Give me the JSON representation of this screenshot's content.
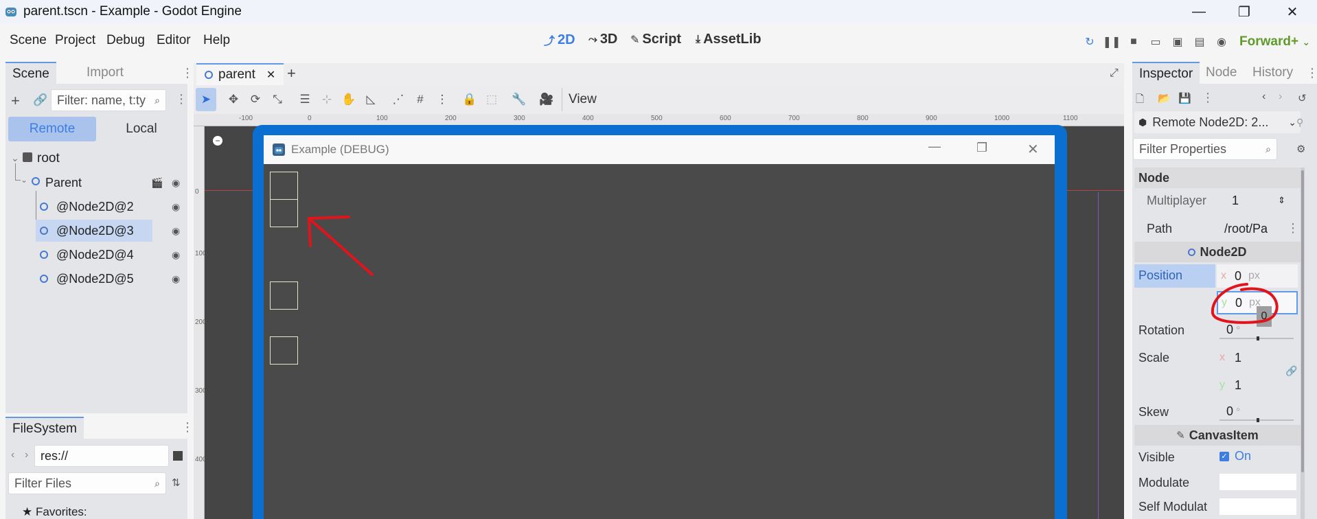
{
  "window": {
    "title": "parent.tscn - Example - Godot Engine",
    "minimize": "—",
    "maximize": "❐",
    "close": "✕"
  },
  "menu": [
    "Scene",
    "Project",
    "Debug",
    "Editor",
    "Help"
  ],
  "modes": {
    "twod": "2D",
    "threed": "3D",
    "script": "Script",
    "assetlib": "AssetLib"
  },
  "renderer": "Forward+",
  "scene_dock": {
    "tabs": [
      "Scene",
      "Import"
    ],
    "filter_placeholder": "Filter: name, t:ty",
    "remote": "Remote",
    "local": "Local",
    "tree": {
      "root": "root",
      "parent": "Parent",
      "children": [
        "@Node2D@2",
        "@Node2D@3",
        "@Node2D@4",
        "@Node2D@5"
      ]
    }
  },
  "filesystem_dock": {
    "tab": "FileSystem",
    "path": "res://",
    "filter_placeholder": "Filter Files",
    "favorites": "Favorites:"
  },
  "viewport": {
    "tab": "parent",
    "add_tab": "+",
    "view_menu": "View",
    "ruler_h": [
      "-100",
      "0",
      "100",
      "200",
      "300",
      "400",
      "500",
      "600",
      "700",
      "800",
      "900",
      "1000",
      "1100"
    ],
    "ruler_v": [
      "0",
      "100",
      "200",
      "300",
      "400"
    ],
    "debug_window_title": "Example (DEBUG)"
  },
  "inspector": {
    "tabs": [
      "Inspector",
      "Node",
      "History"
    ],
    "object": "Remote Node2D: 2...",
    "filter_placeholder": "Filter Properties",
    "node_section": "Node",
    "multiplayer_label": "Multiplayer",
    "multiplayer_value": "1",
    "path_label": "Path",
    "path_value": "/root/Pa",
    "node2d_section": "Node2D",
    "position_label": "Position",
    "position_x": "0",
    "position_y": "0",
    "px": "px",
    "axis_x": "x",
    "axis_y": "y",
    "tooltip_value": "0",
    "rotation_label": "Rotation",
    "rotation_value": "0",
    "degree": "°",
    "scale_label": "Scale",
    "scale_x": "1",
    "scale_y": "1",
    "skew_label": "Skew",
    "skew_value": "0",
    "canvasitem_section": "CanvasItem",
    "visible_label": "Visible",
    "visible_value": "On",
    "modulate_label": "Modulate",
    "self_modulate_label": "Self Modulat"
  },
  "colors": {
    "accent": "#5e9ae8",
    "node_icon": "#4779d2",
    "annotation": "#e0141a",
    "debug_border": "#0b6fd1",
    "renderer_green": "#5f9a2a"
  }
}
